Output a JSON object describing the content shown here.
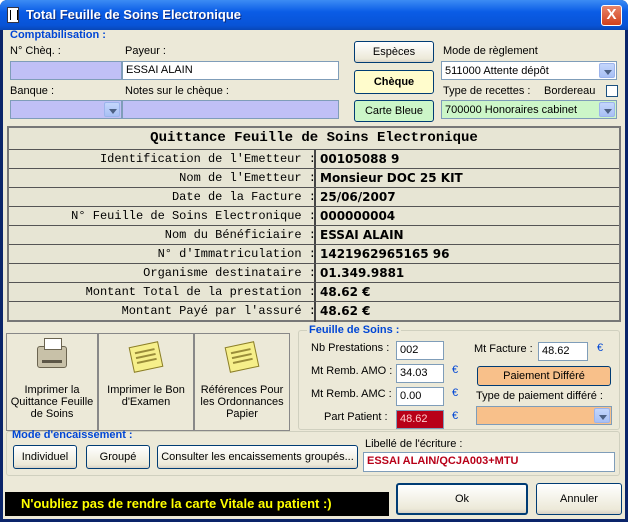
{
  "window": {
    "title": "Total Feuille de Soins Electronique",
    "close_label": "X"
  },
  "comptabilisation": {
    "title": "Comptabilisation :",
    "num_cheque_label": "N° Chèq. :",
    "num_cheque_value": "",
    "payeur_label": "Payeur :",
    "payeur_value": "ESSAI ALAIN",
    "banque_label": "Banque :",
    "banque_value": "",
    "notes_label": "Notes sur le chèque :",
    "notes_value": ""
  },
  "payment_buttons": {
    "especes": "Espèces",
    "cheque": "Chèque",
    "carte_bleue": "Carte Bleue"
  },
  "mode_reglement": {
    "label": "Mode de règlement",
    "value": "511000 Attente dépôt"
  },
  "type_recettes": {
    "label": "Type de recettes :",
    "value": "700000 Honoraires cabinet"
  },
  "bordereau": {
    "label": "Bordereau",
    "checked": false
  },
  "quittance": {
    "title": "Quittance Feuille de Soins Electronique",
    "rows": [
      {
        "label": "Identification de l'Emetteur :",
        "value": "00105088 9"
      },
      {
        "label": "Nom de l'Emetteur :",
        "value": "Monsieur DOC 25 KIT"
      },
      {
        "label": "Date de la Facture :",
        "value": "25/06/2007"
      },
      {
        "label": "N° Feuille de Soins Electronique :",
        "value": "000000004"
      },
      {
        "label": "Nom du Bénéficiaire :",
        "value": "ESSAI ALAIN"
      },
      {
        "label": "N° d'Immatriculation :",
        "value": "1421962965165 96"
      },
      {
        "label": "Organisme destinataire :",
        "value": "01.349.9881"
      },
      {
        "label": "Montant Total de la prestation :",
        "value": "48.62 €"
      },
      {
        "label": "Montant Payé par l'assuré :",
        "value": "48.62 €"
      }
    ]
  },
  "actions": {
    "imprimer_quittance": "Imprimer la Quittance Feuille de Soins",
    "imprimer_bon": "Imprimer le Bon d'Examen",
    "references": "Références Pour les Ordonnances Papier"
  },
  "feuille_de_soins": {
    "title": "Feuille de Soins :",
    "nb_prestations_label": "Nb Prestations :",
    "nb_prestations_value": "002",
    "mt_remb_amo_label": "Mt Remb. AMO :",
    "mt_remb_amo_value": "34.03",
    "mt_remb_amc_label": "Mt Remb. AMC :",
    "mt_remb_amc_value": "0.00",
    "part_patient_label": "Part Patient :",
    "part_patient_value": "48.62",
    "mt_facture_label": "Mt Facture :",
    "mt_facture_value": "48.62",
    "euro": "€",
    "paiement_differe": "Paiement Différé",
    "type_paiement_label": "Type de paiement différé :",
    "type_paiement_value": ""
  },
  "encaissement": {
    "title": "Mode d'encaissement :",
    "individuel": "Individuel",
    "groupe": "Groupé",
    "consulter": "Consulter les encaissements groupés...",
    "libelle_label": "Libellé de l'écriture :",
    "libelle_value": "ESSAI ALAIN/QCJA003+MTU"
  },
  "status_message": "N'oubliez pas de rendre la carte Vitale au patient   :)",
  "footer": {
    "ok": "Ok",
    "annuler": "Annuler"
  },
  "colors": {
    "lavender_field": "#c0c0f6",
    "cheque_bg": "#fffccc",
    "green_field": "#ccf6c8",
    "orange_btn": "#f8c08a",
    "part_patient_bg": "#b80018",
    "status_text": "#ffff00"
  }
}
